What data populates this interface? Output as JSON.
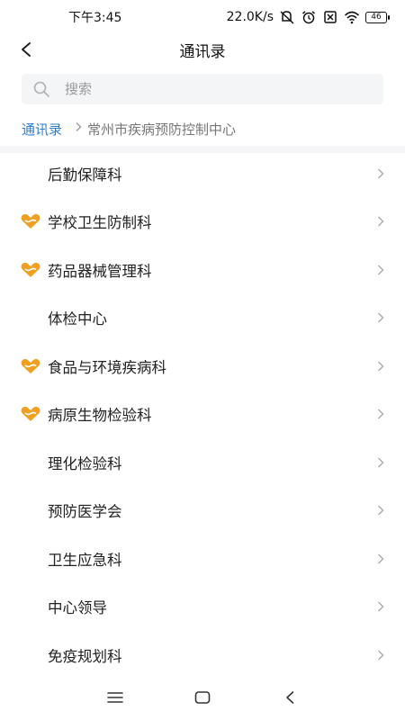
{
  "status_bar": {
    "time": "下午3:45",
    "network_speed": "22.0K/s",
    "battery_level": "46",
    "icons": [
      "mute-icon",
      "alarm-icon",
      "sim-off-icon",
      "wifi-icon",
      "battery-icon"
    ]
  },
  "header": {
    "title": "通讯录",
    "back_icon": "back-arrow-icon"
  },
  "search": {
    "placeholder": "搜索",
    "value": "",
    "icon": "search-icon"
  },
  "breadcrumb": {
    "root": "通讯录",
    "separator_icon": "chevron-right-icon",
    "current": "常州市疾病预防控制中心"
  },
  "departments": [
    {
      "name": "后勤保障科",
      "badge": false
    },
    {
      "name": "学校卫生防制科",
      "badge": true
    },
    {
      "name": "药品器械管理科",
      "badge": true
    },
    {
      "name": "体检中心",
      "badge": false
    },
    {
      "name": "食品与环境疾病科",
      "badge": true
    },
    {
      "name": "病原生物检验科",
      "badge": true
    },
    {
      "name": "理化检验科",
      "badge": false
    },
    {
      "name": "预防医学会",
      "badge": false
    },
    {
      "name": "卫生应急科",
      "badge": false
    },
    {
      "name": "中心领导",
      "badge": false
    },
    {
      "name": "免疫规划科",
      "badge": false
    }
  ],
  "colors": {
    "accent": "#2a7fd6",
    "badge": "#f0a020",
    "search_bg": "#f4f5f7"
  },
  "bottom_nav": {
    "items": [
      "menu-icon",
      "home-icon",
      "back-icon"
    ]
  }
}
